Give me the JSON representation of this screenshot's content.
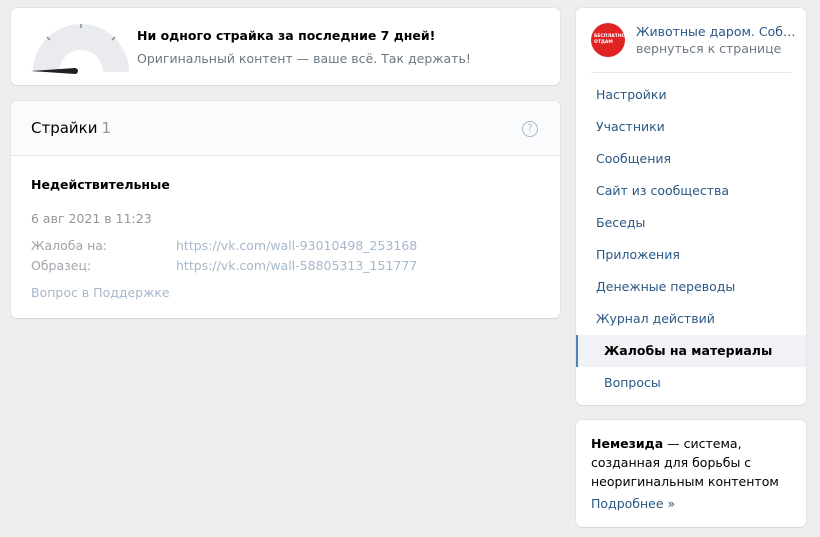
{
  "banner": {
    "title": "Ни одного страйка за последние 7 дней!",
    "subtitle": "Оригинальный контент — ваше всё. Так держать!",
    "gauge_level": 0
  },
  "strikes": {
    "title": "Страйки",
    "count": "1",
    "help_glyph": "?",
    "status": "Недействительные",
    "date": "6 авг 2021 в 11:23",
    "complaint_label": "Жалоба на:",
    "complaint_link": "https://vk.com/wall-93010498_253168",
    "sample_label": "Образец:",
    "sample_link": "https://vk.com/wall-58805313_151777",
    "support_link": "Вопрос в Поддержке"
  },
  "group": {
    "name": "Животные даром. Собаки...",
    "back_link": "вернуться к странице",
    "avatar_line1": "БЕСПЛАТНО",
    "avatar_line2": "ОТДАМ",
    "avatar_color": "#e02424"
  },
  "menu": {
    "items": [
      {
        "label": "Настройки"
      },
      {
        "label": "Участники"
      },
      {
        "label": "Сообщения"
      },
      {
        "label": "Сайт из сообщества"
      },
      {
        "label": "Беседы"
      },
      {
        "label": "Приложения"
      },
      {
        "label": "Денежные переводы"
      },
      {
        "label": "Журнал действий"
      },
      {
        "label": "Жалобы на материалы"
      },
      {
        "label": "Вопросы"
      }
    ]
  },
  "info": {
    "bold": "Немезида",
    "text": " — система, созданная для борьбы с неоригинальным контентом",
    "more": "Подробнее »"
  },
  "colors": {
    "accent": "#5181b8",
    "link": "#2a5885",
    "background": "#edeef0"
  }
}
